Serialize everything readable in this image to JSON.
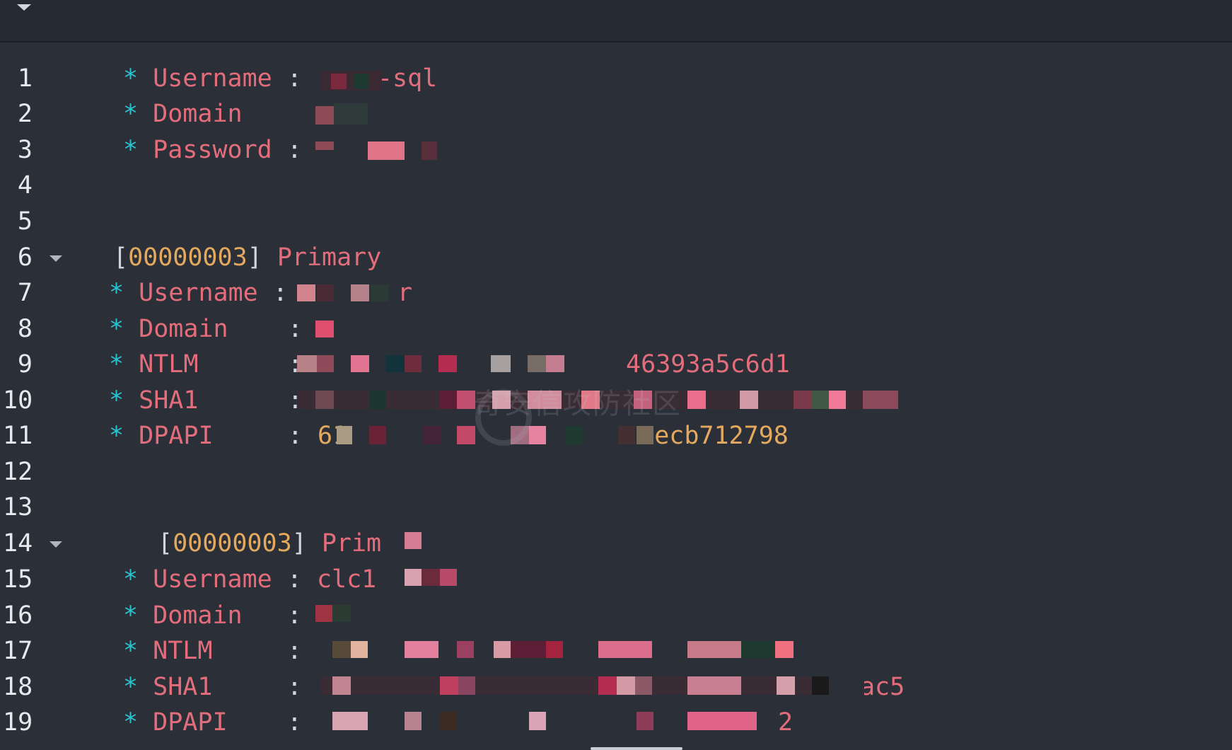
{
  "lines": [
    {
      "n": "1",
      "indent": 174,
      "bullet": "*",
      "key": "Username",
      "sep": ":",
      "val": "-sql"
    },
    {
      "n": "2",
      "indent": 174,
      "bullet": "*",
      "key": "Domain",
      "sep": "",
      "val": ""
    },
    {
      "n": "3",
      "indent": 174,
      "bullet": "*",
      "key": "Password",
      "sep": ":",
      "val": ""
    },
    {
      "n": "4"
    },
    {
      "n": "5"
    },
    {
      "n": "6",
      "indent": 160,
      "fold": true,
      "bracket_open": "[",
      "number": "00000003",
      "bracket_close": "]",
      "label": "Primary"
    },
    {
      "n": "7",
      "indent": 154,
      "bullet": "*",
      "key": "Username",
      "sep": ":",
      "val": "r"
    },
    {
      "n": "8",
      "indent": 154,
      "bullet": "*",
      "key": "Domain",
      "sep": ":",
      "val": ""
    },
    {
      "n": "9",
      "indent": 154,
      "bullet": "*",
      "key": "NTLM",
      "sep": ":",
      "val": "46393a5c6d1"
    },
    {
      "n": "10",
      "indent": 154,
      "bullet": "*",
      "key": "SHA1",
      "sep": ":",
      "val": ""
    },
    {
      "n": "11",
      "indent": 154,
      "bullet": "*",
      "key": "DPAPI",
      "sep": ":",
      "val": "61",
      "val2": "ecb712798"
    },
    {
      "n": "12"
    },
    {
      "n": "13"
    },
    {
      "n": "14",
      "indent": 223,
      "fold": true,
      "bracket_open": "[",
      "number": "00000003",
      "bracket_close": "]",
      "label": "Prim"
    },
    {
      "n": "15",
      "indent": 174,
      "bullet": "*",
      "key": "Username",
      "sep": ":",
      "val": "clc1"
    },
    {
      "n": "16",
      "indent": 174,
      "bullet": "*",
      "key": "Domain",
      "sep": ":",
      "val": ""
    },
    {
      "n": "17",
      "indent": 174,
      "bullet": "*",
      "key": "NTLM",
      "sep": ":",
      "val": ""
    },
    {
      "n": "18",
      "indent": 174,
      "bullet": "*",
      "key": "SHA1",
      "sep": ":",
      "val": "ac5"
    },
    {
      "n": "19",
      "indent": 174,
      "bullet": "*",
      "key": "DPAPI",
      "sep": ":",
      "val": "2"
    }
  ],
  "watermark": "奇安信攻防社区",
  "colors": {
    "background": "#2a2f38",
    "key": "#e46d7b",
    "bullet": "#29c3cf",
    "number": "#e5a95e",
    "line_number": "#e6e9ee"
  },
  "icons": {
    "collapse": "caret-down-icon",
    "fold": "fold-arrow-icon"
  }
}
